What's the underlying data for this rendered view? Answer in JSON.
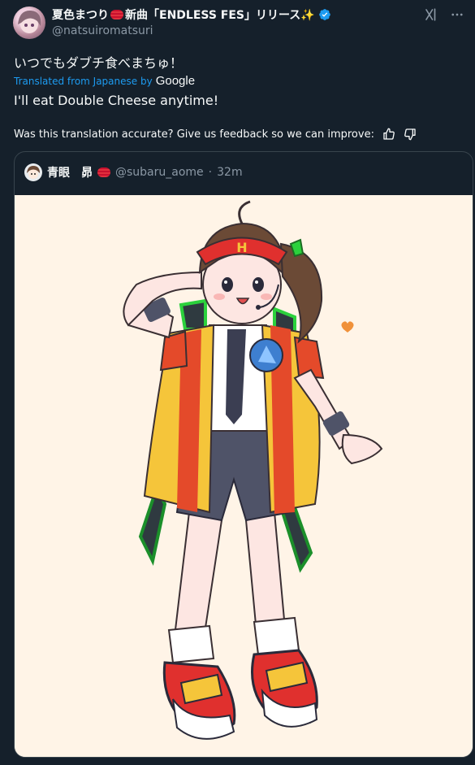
{
  "author": {
    "display_name_prefix": "夏色まつり",
    "display_name_suffix": "新曲「ENDLESS FES」リリース✨",
    "handle": "@natsuiromatsuri",
    "verified": true
  },
  "tweet": {
    "original_text": "いつでもダブチ食べまちゅ！",
    "translated_from_label": "Translated from Japanese by",
    "translator_brand": "Google",
    "translated_text": "I'll eat Double Cheese anytime!",
    "feedback_prompt": "Was this translation accurate? Give us feedback so we can improve:"
  },
  "quote": {
    "display_name": "青眼　昴",
    "handle": "@subaru_aome",
    "separator": "·",
    "time": "32m"
  },
  "icons": {
    "verified": "verified-badge-icon",
    "grok": "grok-icon",
    "more": "more-icon",
    "thumbs_up": "thumbs-up-icon",
    "thumbs_down": "thumbs-down-icon"
  },
  "colors": {
    "background": "#15202b",
    "accent": "#1d9bf0",
    "secondary_text": "#8b98a5",
    "border": "#38444d",
    "artwork_background": "#fff4e7"
  }
}
